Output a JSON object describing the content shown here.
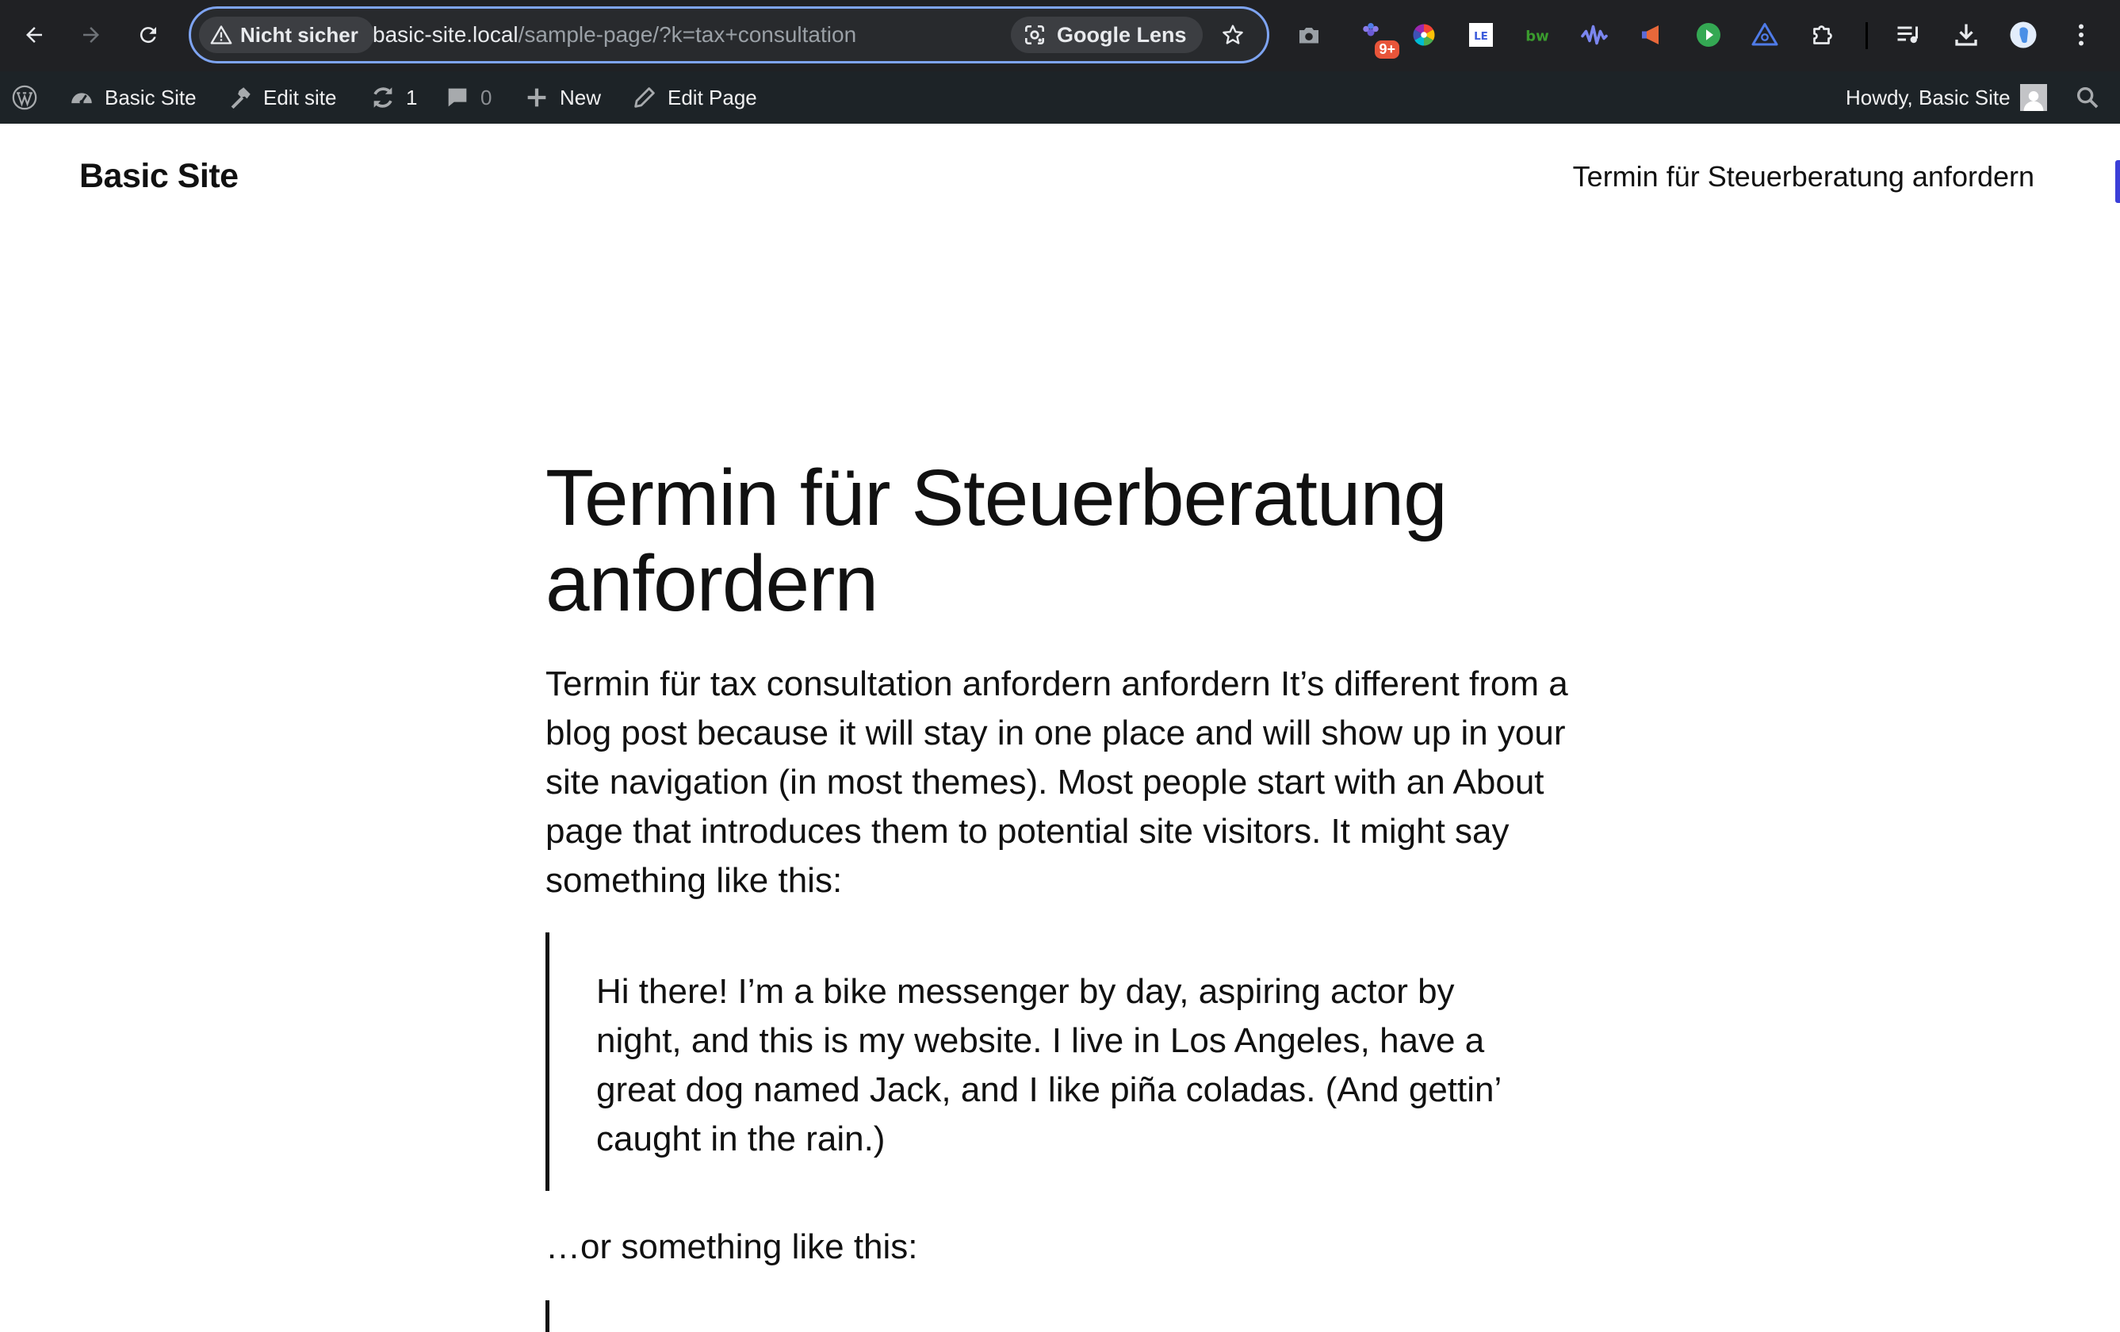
{
  "browser": {
    "security_label": "Nicht sicher",
    "url_host": "basic-site.local",
    "url_path": "/sample-page/?k=tax+consultation",
    "lens_label": "Google Lens",
    "extension_badge": "9+"
  },
  "adminbar": {
    "site_name": "Basic Site",
    "edit_site": "Edit site",
    "updates_count": "1",
    "comments_count": "0",
    "new_label": "New",
    "edit_page": "Edit Page",
    "howdy": "Howdy, Basic Site"
  },
  "site": {
    "title": "Basic Site",
    "nav_item": "Termin für Steuerberatung anfordern"
  },
  "content": {
    "page_title": "Termin für Steuerberatung anfordern",
    "intro": "Termin für tax consultation anfordern anfordern It’s different from a blog post because it will stay in one place and will show up in your site navigation (in most themes). Most people start with an About page that introduces them to potential site visitors. It might say something like this:",
    "quote": "Hi there! I’m a bike messenger by day, aspiring actor by night, and this is my website. I live in Los Angeles, have a great dog named Jack, and I like piña coladas. (And gettin’ caught in the rain.)",
    "outro": "…or something like this:"
  },
  "colors": {
    "chrome_bg": "#202124",
    "omnibox_border": "#7ea4f2",
    "adminbar_bg": "#1d2327",
    "text": "#111111"
  }
}
